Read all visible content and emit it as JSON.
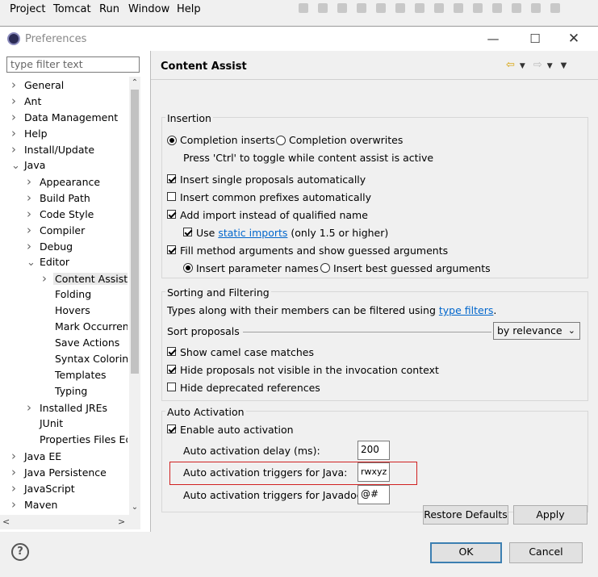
{
  "menubar": {
    "items": [
      "Project",
      "Tomcat",
      "Run",
      "Window",
      "Help"
    ]
  },
  "dialog": {
    "title": "Preferences",
    "icons": {
      "minimize": "minimize-icon",
      "maximize": "maximize-icon",
      "close": "close-icon"
    }
  },
  "filter": {
    "placeholder": "type filter text"
  },
  "tree": {
    "items": [
      {
        "label": "General",
        "expander": "collapsed",
        "indent": 0
      },
      {
        "label": "Ant",
        "expander": "collapsed",
        "indent": 0
      },
      {
        "label": "Data Management",
        "expander": "collapsed",
        "indent": 0
      },
      {
        "label": "Help",
        "expander": "collapsed",
        "indent": 0
      },
      {
        "label": "Install/Update",
        "expander": "collapsed",
        "indent": 0
      },
      {
        "label": "Java",
        "expander": "expanded",
        "indent": 0
      },
      {
        "label": "Appearance",
        "expander": "collapsed",
        "indent": 1
      },
      {
        "label": "Build Path",
        "expander": "collapsed",
        "indent": 1
      },
      {
        "label": "Code Style",
        "expander": "collapsed",
        "indent": 1
      },
      {
        "label": "Compiler",
        "expander": "collapsed",
        "indent": 1
      },
      {
        "label": "Debug",
        "expander": "collapsed",
        "indent": 1
      },
      {
        "label": "Editor",
        "expander": "expanded",
        "indent": 1
      },
      {
        "label": "Content Assist",
        "expander": "collapsed",
        "indent": 2,
        "selected": true
      },
      {
        "label": "Folding",
        "expander": "none",
        "indent": 2
      },
      {
        "label": "Hovers",
        "expander": "none",
        "indent": 2
      },
      {
        "label": "Mark Occurren",
        "expander": "none",
        "indent": 2
      },
      {
        "label": "Save Actions",
        "expander": "none",
        "indent": 2
      },
      {
        "label": "Syntax Coloring",
        "expander": "none",
        "indent": 2
      },
      {
        "label": "Templates",
        "expander": "none",
        "indent": 2
      },
      {
        "label": "Typing",
        "expander": "none",
        "indent": 2
      },
      {
        "label": "Installed JREs",
        "expander": "collapsed",
        "indent": 1
      },
      {
        "label": "JUnit",
        "expander": "none",
        "indent": 1
      },
      {
        "label": "Properties Files Ed",
        "expander": "none",
        "indent": 1
      },
      {
        "label": "Java EE",
        "expander": "collapsed",
        "indent": 0
      },
      {
        "label": "Java Persistence",
        "expander": "collapsed",
        "indent": 0
      },
      {
        "label": "JavaScript",
        "expander": "collapsed",
        "indent": 0
      },
      {
        "label": "Maven",
        "expander": "collapsed",
        "indent": 0
      }
    ]
  },
  "page": {
    "title": "Content Assist",
    "nav_icons": [
      "back-arrow-icon",
      "dropdown-icon",
      "forward-arrow-icon",
      "dropdown-icon",
      "view-menu-icon"
    ]
  },
  "insertion": {
    "legend": "Insertion",
    "completion_inserts": "Completion inserts",
    "completion_overwrites": "Completion overwrites",
    "toggle_hint": "Press 'Ctrl' to toggle while content assist is active",
    "single_proposals": "Insert single proposals automatically",
    "common_prefixes": "Insert common prefixes automatically",
    "add_import": "Add import instead of qualified name",
    "use_prefix": "Use",
    "static_imports_link": "static imports",
    "use_suffix": "(only 1.5 or higher)",
    "fill_method_args": "Fill method arguments and show guessed arguments",
    "insert_param_names": "Insert parameter names",
    "insert_best_guessed": "Insert best guessed arguments"
  },
  "sorting": {
    "legend": "Sorting and Filtering",
    "types_text": "Types along with their members can be filtered using",
    "type_filters_link": "type filters",
    "period": ".",
    "sort_label": "Sort proposals",
    "sort_value": "by relevance",
    "camel_case": "Show camel case matches",
    "hide_not_visible": "Hide proposals not visible in the invocation context",
    "hide_deprecated": "Hide deprecated references"
  },
  "auto": {
    "legend": "Auto Activation",
    "enable": "Enable auto activation",
    "delay_label": "Auto activation delay (ms):",
    "delay_value": "200",
    "java_triggers_label": "Auto activation triggers for Java:",
    "java_triggers_value": "rwxyz",
    "javadoc_triggers_label": "Auto activation triggers for Javadoc:",
    "javadoc_triggers_value": "@#"
  },
  "buttons": {
    "restore_defaults": "Restore Defaults",
    "apply": "Apply",
    "ok": "OK",
    "cancel": "Cancel",
    "help": "?"
  }
}
